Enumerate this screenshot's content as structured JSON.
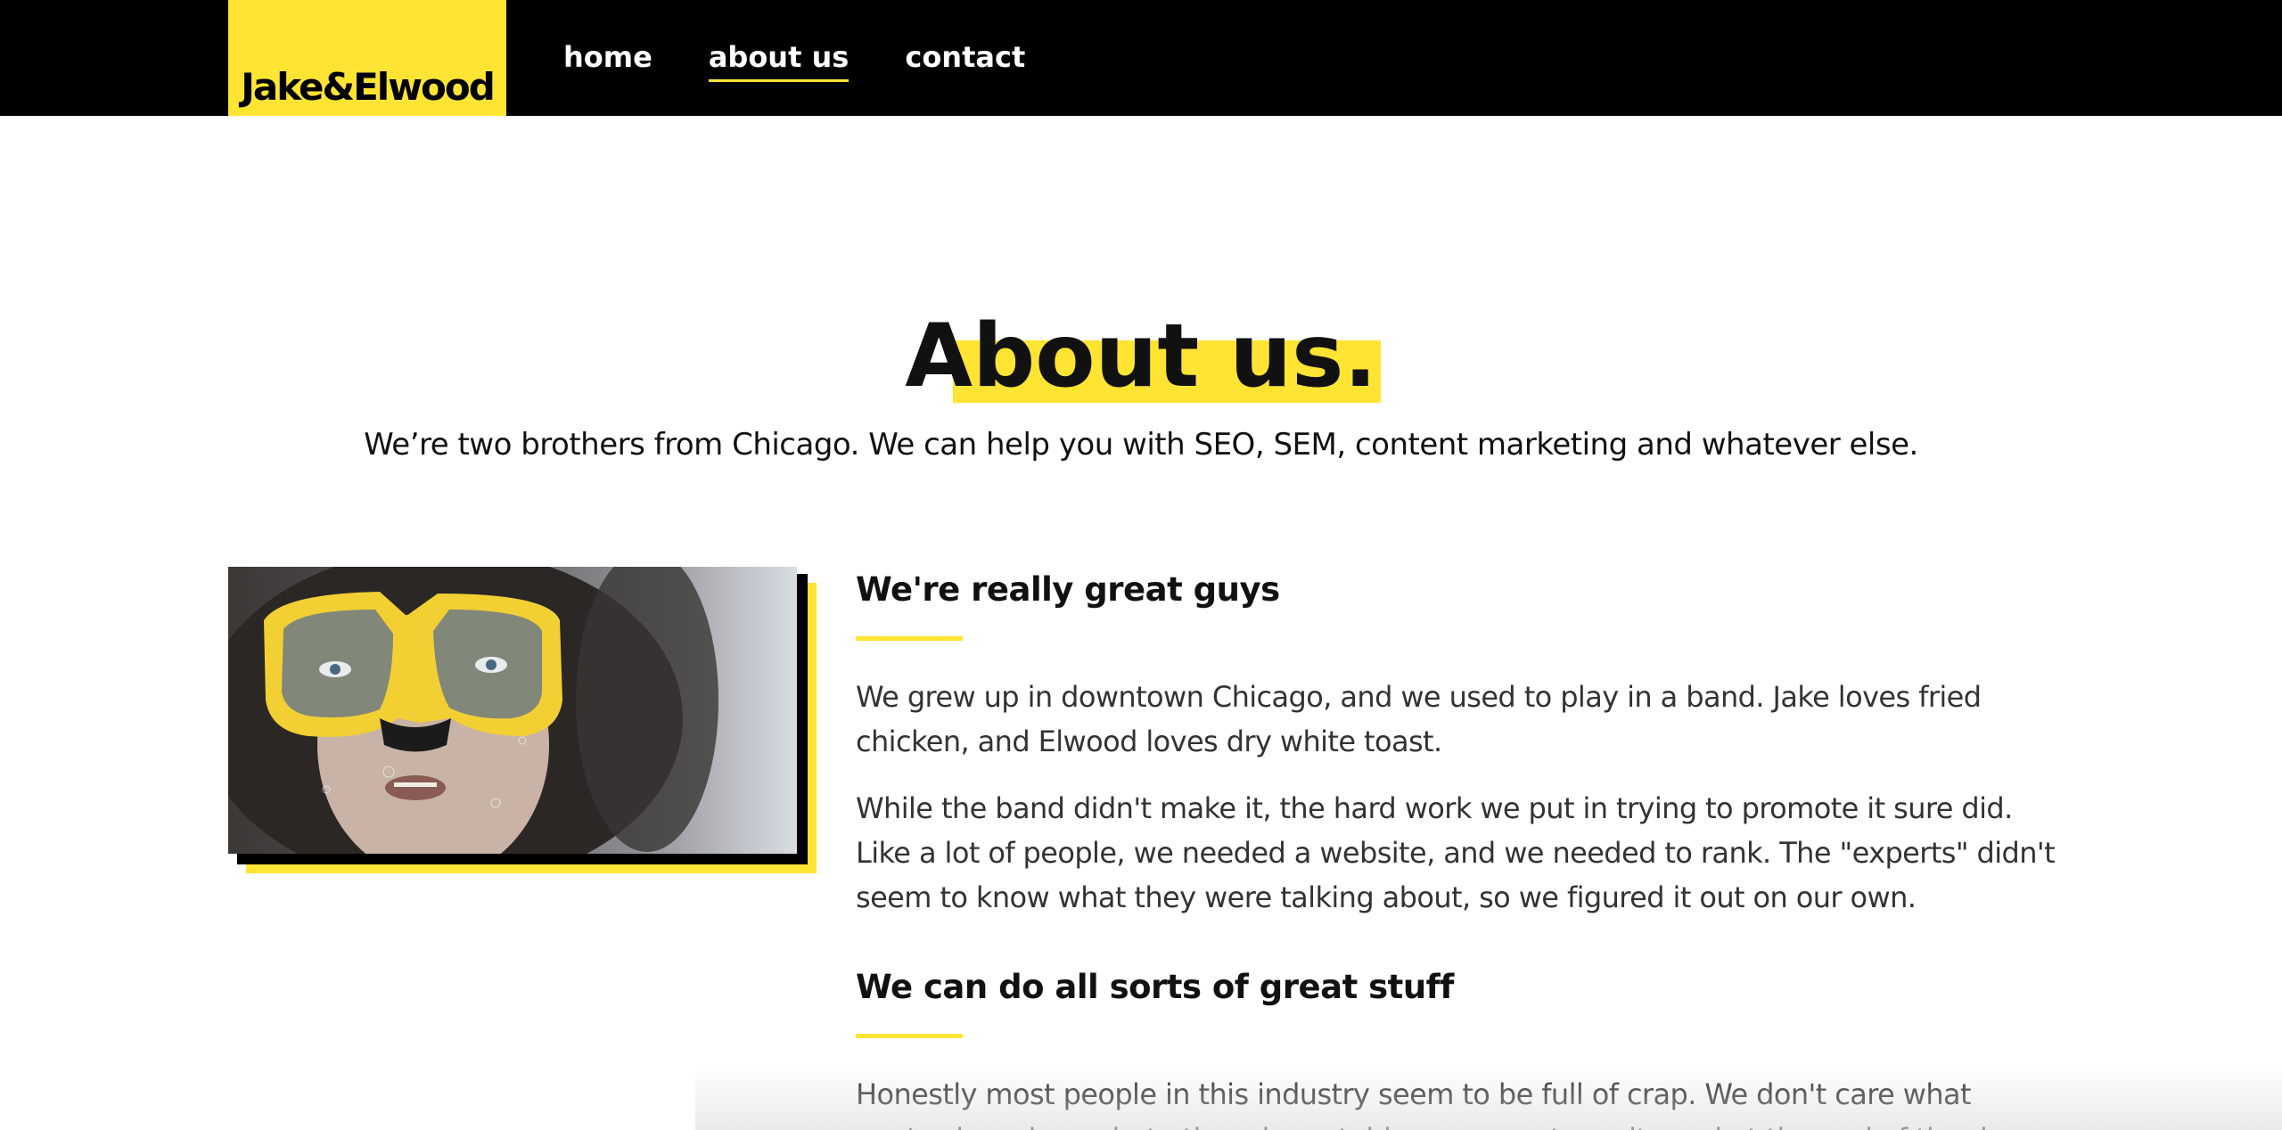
{
  "header": {
    "logo": "Jake&Elwood",
    "nav": [
      {
        "label": "home"
      },
      {
        "label": "about us"
      },
      {
        "label": "contact"
      }
    ]
  },
  "hero": {
    "title": "About us.",
    "intro": "We’re two brothers from Chicago. We can help you with SEO, SEM, content marketing and whatever else."
  },
  "sections": [
    {
      "title": "We're really great guys",
      "paragraphs": [
        "We grew up in downtown Chicago, and we used to play in a band. Jake loves fried chicken, and Elwood loves dry white toast.",
        "While the band didn't make it, the hard work we put in trying to promote it sure did. Like a lot of people, we needed a website, and we needed to rank. The \"experts\" didn't seem to know what they were talking about, so we figured it out on our own."
      ]
    },
    {
      "title": "We can do all sorts of great stuff",
      "paragraphs": [
        "Honestly most people in this industry seem to be full of crap. We don't care what you've heard, or what others have told you, we get results and at the end of the day"
      ]
    }
  ],
  "colors": {
    "accent": "#ffe433",
    "header_bg": "#000000"
  }
}
